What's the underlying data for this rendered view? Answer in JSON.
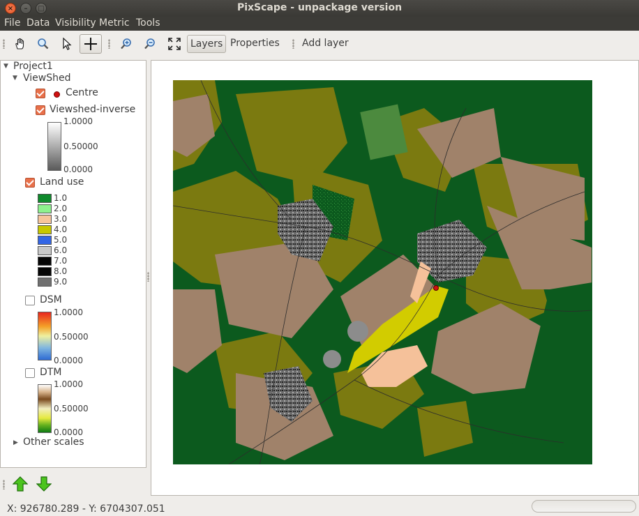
{
  "window": {
    "title": "PixScape - unpackage version"
  },
  "menu": [
    "File",
    "Data",
    "Visibility",
    "Metric",
    "Tools"
  ],
  "toolbar": {
    "layers_label": "Layers",
    "properties_label": "Properties",
    "add_layer_label": "Add layer"
  },
  "tree": {
    "project": "Project1",
    "viewshed_group": "ViewShed",
    "centre": "Centre",
    "viewshed_inverse": "Viewshed-inverse",
    "viewshed_ramp": {
      "max": "1.0000",
      "mid": "0.50000",
      "min": "0.0000"
    },
    "land_use": "Land use",
    "land_use_legend": [
      {
        "label": "1.0",
        "color": "#0f8a2c"
      },
      {
        "label": "2.0",
        "color": "#8ef28e"
      },
      {
        "label": "3.0",
        "color": "#f7c59b"
      },
      {
        "label": "4.0",
        "color": "#c8c800"
      },
      {
        "label": "5.0",
        "color": "#3366e6"
      },
      {
        "label": "6.0",
        "color": "#c8c8c8"
      },
      {
        "label": "7.0",
        "color": "#050505"
      },
      {
        "label": "8.0",
        "color": "#050505"
      },
      {
        "label": "9.0",
        "color": "#707070"
      }
    ],
    "dsm": "DSM",
    "dsm_ramp": {
      "max": "1.0000",
      "mid": "0.50000",
      "min": "0.0000"
    },
    "dtm": "DTM",
    "dtm_ramp": {
      "max": "1.0000",
      "mid": "0.50000",
      "min": "0.0000"
    },
    "other_scales": "Other scales"
  },
  "status": {
    "coords": "X: 926780.289 - Y: 6704307.051"
  },
  "colors": {
    "forest": "#0c5a1e",
    "agri": "#7b7a10",
    "brown": "#a0826a",
    "urban": "#6e6e6e",
    "viewshed_yellow": "#d2cc00",
    "viewshed_peach": "#f5c19a"
  }
}
